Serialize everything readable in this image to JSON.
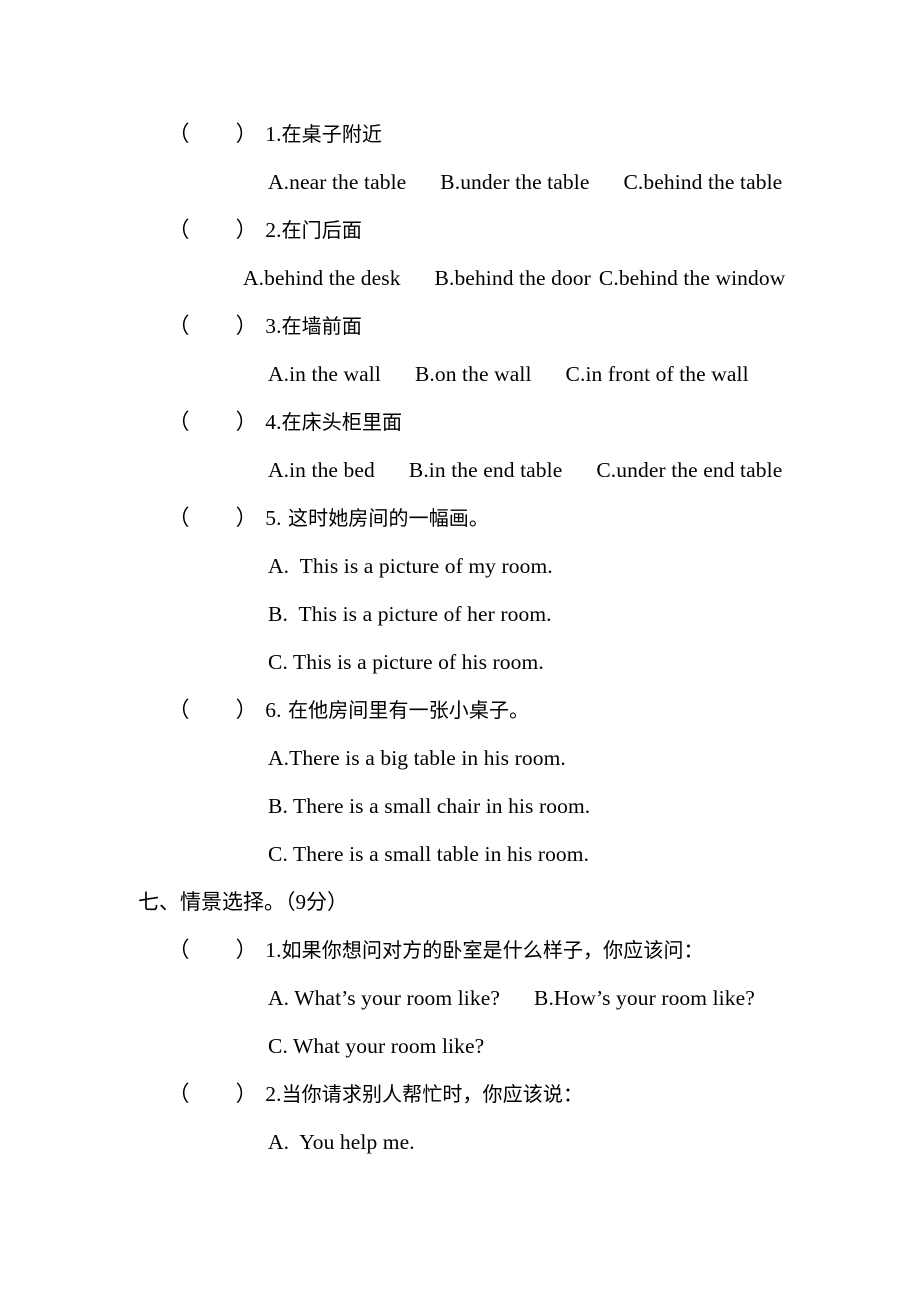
{
  "document": {
    "type": "worksheet-page",
    "language": "zh-CN + en",
    "text_color": "#000000",
    "background_color": "#ffffff"
  },
  "questions_top": [
    {
      "marker_open": "（",
      "marker_close": "）",
      "number": "1.",
      "stem": "在桌子附近",
      "option_a": "A.near the table",
      "option_b": "B.under the table",
      "option_c": "C.behind the table"
    },
    {
      "marker_open": "（",
      "marker_close": "）",
      "number": "2.",
      "stem": "在门后面",
      "option_a": "A.behind the desk",
      "option_b": "B.behind the door",
      "option_c": "C.behind the window"
    },
    {
      "marker_open": "（",
      "marker_close": "）",
      "number": "3.",
      "stem": "在墙前面",
      "option_a": "A.in the wall",
      "option_b": "B.on the wall",
      "option_c": "C.in front of the wall"
    },
    {
      "marker_open": "（",
      "marker_close": "）",
      "number": "4.",
      "stem": "在床头柜里面",
      "option_a": "A.in the bed",
      "option_b": "B.in the end table",
      "option_c": "C.under the end table"
    },
    {
      "marker_open": "（",
      "marker_close": "）",
      "number": "5.",
      "stem": " 这时她房间的一幅画。",
      "option_a": "A.  This is a picture of my room.",
      "option_b": "B.  This is a picture of her room.",
      "option_c": "C. This is a picture of his room."
    },
    {
      "marker_open": "（",
      "marker_close": "）",
      "number": "6.",
      "stem": " 在他房间里有一张小桌子。",
      "option_a": "A.There is a big table in his room.",
      "option_b": "B. There is a small chair in his room.",
      "option_c": "C. There is a small table in his room."
    }
  ],
  "section_seven": {
    "number": "七、",
    "title": "情景选择。",
    "score": "（9分）",
    "questions": [
      {
        "marker_open": "（",
        "marker_close": "）",
        "number": "1.",
        "stem": "如果你想问对方的卧室是什么样子，你应该问：",
        "option_a": "A. What’s your room like?",
        "option_b": "B.How’s your room like?",
        "option_c": "C. What your room like?"
      },
      {
        "marker_open": "（",
        "marker_close": "）",
        "number": "2.",
        "stem": "当你请求别人帮忙时，你应该说：",
        "option_a": "A.  You help me."
      }
    ]
  }
}
